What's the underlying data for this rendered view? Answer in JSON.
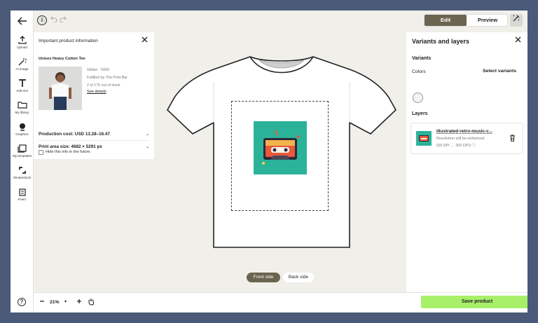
{
  "top": {
    "back_icon": "arrow-left-icon",
    "info_icon": "info-icon",
    "undo_icon": "undo-icon",
    "redo_icon": "redo-icon",
    "edit_label": "Edit",
    "preview_label": "Preview",
    "magic_icon": "magic-wand-icon"
  },
  "rail": {
    "items": [
      {
        "label": "Upload",
        "icon": "upload-icon"
      },
      {
        "label": "AI image",
        "icon": "ai-sparkle-icon"
      },
      {
        "label": "Add text",
        "icon": "text-icon"
      },
      {
        "label": "My library",
        "icon": "folder-icon"
      },
      {
        "label": "Graphics",
        "icon": "graphics-icon"
      },
      {
        "label": "My templates",
        "icon": "templates-icon"
      },
      {
        "label": "Shutterstock",
        "icon": "shutterstock-icon"
      },
      {
        "label": "Fiverr",
        "icon": "fiverr-icon"
      }
    ],
    "help_glyph": "?"
  },
  "info_panel": {
    "title": "Important product information",
    "product_name": "Unisex Heavy Cotton Tee",
    "brand": "Gildan · 5000",
    "fulfilled": "Fulfilled by The Print Bar",
    "stock": "2 of 175 out of stock",
    "details_link": "See details",
    "production_cost": "Production cost: USD 13.28–16.47",
    "print_area_size": "Print area size: 4682 × 5291 px",
    "hide_label": "Hide this info in the future."
  },
  "canvas": {
    "front_label": "Front side",
    "back_label": "Back side",
    "colors": {
      "shirt": "#ffffff",
      "design_bg": "#2bb39a",
      "cassette": "#e8583a"
    }
  },
  "bottom": {
    "zoom": "21%",
    "save_label": "Save product"
  },
  "right_panel": {
    "title": "Variants and layers",
    "variants_heading": "Variants",
    "colors_label": "Colors",
    "select_variants": "Select variants",
    "layers_heading": "Layers",
    "layer": {
      "name": "illustrated-retro-music-c...",
      "note": "Resolution will be enhanced",
      "dpi": "(59 DPI → 300 DPI)"
    }
  },
  "colors": {
    "accent": "#6a6450",
    "save": "#a8f06a",
    "frame": "#4a5a78"
  }
}
